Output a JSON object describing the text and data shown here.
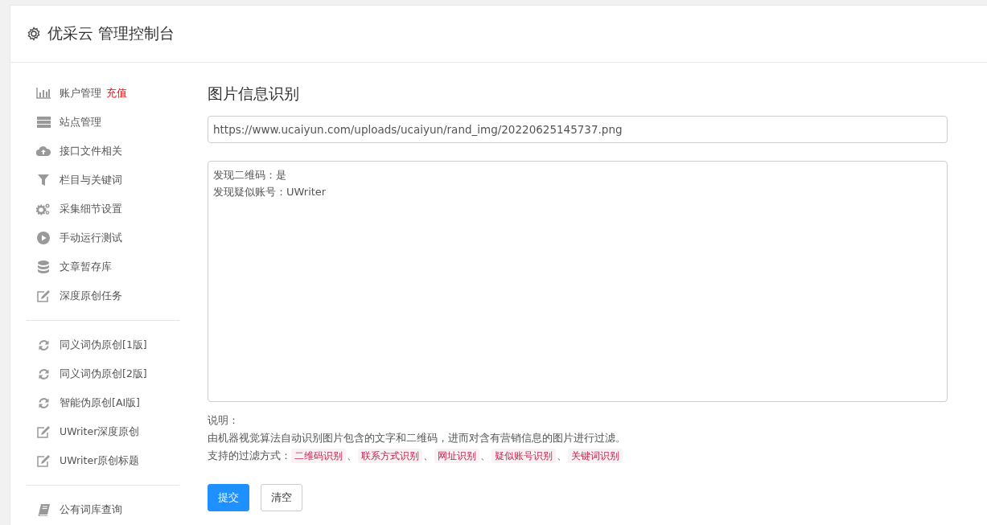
{
  "header": {
    "title": "优采云 管理控制台"
  },
  "sidebar": {
    "groups": [
      {
        "items": [
          {
            "kind": "chart",
            "label": "账户管理",
            "badge": "充值"
          },
          {
            "kind": "server",
            "label": "站点管理"
          },
          {
            "kind": "cloud",
            "label": "接口文件相关"
          },
          {
            "kind": "filter",
            "label": "栏目与关键词"
          },
          {
            "kind": "gears",
            "label": "采集细节设置"
          },
          {
            "kind": "play",
            "label": "手动运行测试"
          },
          {
            "kind": "database",
            "label": "文章暂存库"
          },
          {
            "kind": "edit",
            "label": "深度原创任务"
          }
        ]
      },
      {
        "items": [
          {
            "kind": "refresh",
            "label": "同义词伪原创[1版]"
          },
          {
            "kind": "refresh",
            "label": "同义词伪原创[2版]"
          },
          {
            "kind": "refresh",
            "label": "智能伪原创[AI版]"
          },
          {
            "kind": "edit",
            "label": "UWriter深度原创"
          },
          {
            "kind": "edit",
            "label": "UWriter原创标题"
          }
        ]
      },
      {
        "items": [
          {
            "kind": "book",
            "label": "公有词库查询"
          }
        ]
      }
    ]
  },
  "main": {
    "heading": "图片信息识别",
    "url_field": {
      "value": "https://www.ucaiyun.com/uploads/ucaiyun/rand_img/20220625145737.png"
    },
    "result_box": {
      "lines": [
        "发现二维码：是",
        "发现疑似账号：UWriter"
      ]
    },
    "notes": {
      "title": "说明：",
      "description": "由机器视觉算法自动识别图片包含的文字和二维码，进而对含有营销信息的图片进行过滤。",
      "methods_label": "支持的过滤方式：",
      "separator": "、",
      "methods": [
        "二维码识别",
        "联系方式识别",
        "网址识别",
        "疑似账号识别",
        "关键词识别"
      ]
    },
    "buttons": [
      {
        "kind": "primary",
        "label": "提交"
      },
      {
        "kind": "default",
        "label": "清空"
      }
    ]
  }
}
